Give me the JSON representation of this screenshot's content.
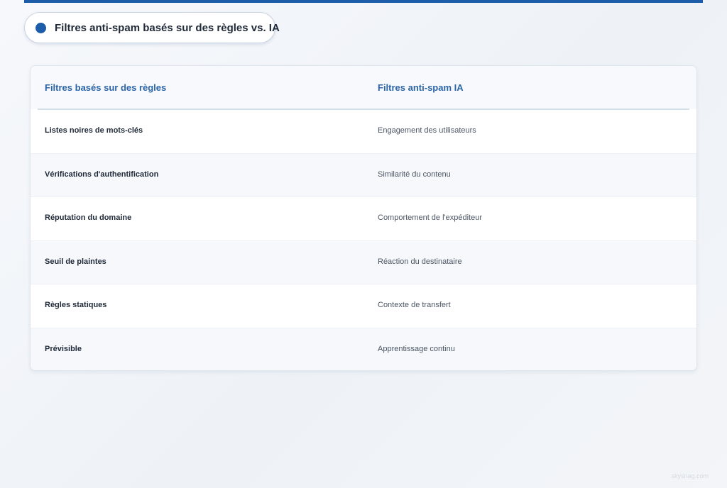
{
  "header": {
    "title": "Filtres anti-spam basés sur des règles vs. IA"
  },
  "table": {
    "columns": [
      "Filtres basés sur des règles",
      "Filtres anti-spam IA"
    ],
    "rows": [
      {
        "rule": "Listes noires de mots-clés",
        "ai": "Engagement des utilisateurs"
      },
      {
        "rule": "Vérifications d'authentification",
        "ai": "Similarité du contenu"
      },
      {
        "rule": "Réputation du domaine",
        "ai": "Comportement de l'expéditeur"
      },
      {
        "rule": "Seuil de plaintes",
        "ai": "Réaction du destinataire"
      },
      {
        "rule": "Règles statiques",
        "ai": "Contexte de transfert"
      },
      {
        "rule": "Prévisible",
        "ai": "Apprentissage continu"
      }
    ]
  },
  "footer": {
    "watermark": "skysnag.com"
  },
  "colors": {
    "accent": "#1d5ca8",
    "header_text": "#2b65a7"
  }
}
